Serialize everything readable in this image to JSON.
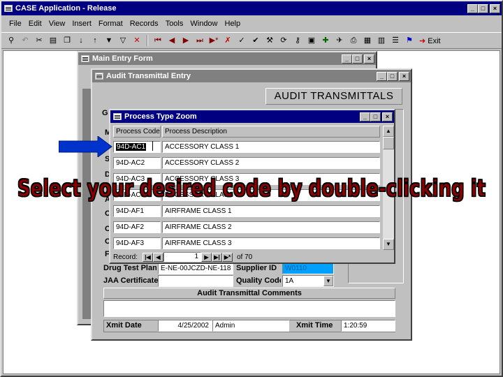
{
  "app": {
    "title": "CASE Application - Release"
  },
  "menu": [
    "File",
    "Edit",
    "View",
    "Insert",
    "Format",
    "Records",
    "Tools",
    "Window",
    "Help"
  ],
  "toolbar": {
    "icons": [
      "binoculars-icon",
      "undo-icon",
      "cut-icon",
      "paste-icon",
      "copy-icon",
      "sort-ascending-icon",
      "sort-descending-icon",
      "filter-selection-icon",
      "filter-form-icon",
      "remove-filter-icon",
      "first-record-icon",
      "previous-record-icon",
      "next-record-icon",
      "last-record-icon",
      "new-record-icon",
      "delete-record-icon",
      "check-icon",
      "spelling-icon",
      "tools-icon",
      "sync-icon",
      "key-icon",
      "properties-icon",
      "chart-icon",
      "fax-icon",
      "print-icon",
      "form-icon",
      "table-icon",
      "list-icon",
      "funnel-icon"
    ],
    "exit_label": "Exit"
  },
  "main_form": {
    "title": "Main Entry Form"
  },
  "audit_form": {
    "title": "Audit Transmittal Entry",
    "header": "AUDIT TRANSMITTALS",
    "partial_labels": [
      "G",
      "M",
      "S",
      "D",
      "A",
      "C",
      "C",
      "C",
      "F"
    ],
    "drug_test_label": "Drug Test Plan",
    "drug_test_value": "E-NE-00JCZD-NE-118",
    "supplier_label": "Supplier ID",
    "supplier_value": "W0110",
    "jaa_label": "JAA Certificate",
    "jaa_value": "",
    "quality_label": "Quality Code",
    "quality_value": "1A",
    "comments_label": "Audit Transmittal Comments",
    "comments_value": "",
    "xmit_date_label": "Xmit Date",
    "xmit_date_value": "4/25/2002",
    "user_value": "Admin",
    "xmit_time_label": "Xmit Time",
    "xmit_time_value": "1:20:59"
  },
  "zoom": {
    "title": "Process Type Zoom",
    "col_code": "Process Code",
    "col_desc": "Process Description",
    "rows": [
      {
        "code": "94D-AC1",
        "desc": "ACCESSORY CLASS 1"
      },
      {
        "code": "94D-AC2",
        "desc": "ACCESSORY CLASS 2"
      },
      {
        "code": "94D-AC3",
        "desc": "ACCESSORY CLASS 3"
      },
      {
        "code": "94D-AC5",
        "desc": "ACCESSORY CLASS 5"
      },
      {
        "code": "94D-AF1",
        "desc": "AIRFRAME CLASS 1"
      },
      {
        "code": "94D-AF2",
        "desc": "AIRFRAME CLASS 2"
      },
      {
        "code": "94D-AF3",
        "desc": "AIRFRAME CLASS 3"
      }
    ],
    "nav_label": "Record:",
    "record_num": "1",
    "of_label": "of 70"
  },
  "instruction": "Select your desired code by double-clicking it",
  "colors": {
    "titlebar": "#000080",
    "arrow": "#0033cc",
    "instruction": "#8b0000",
    "supplier_bg": "#00a0ff"
  }
}
